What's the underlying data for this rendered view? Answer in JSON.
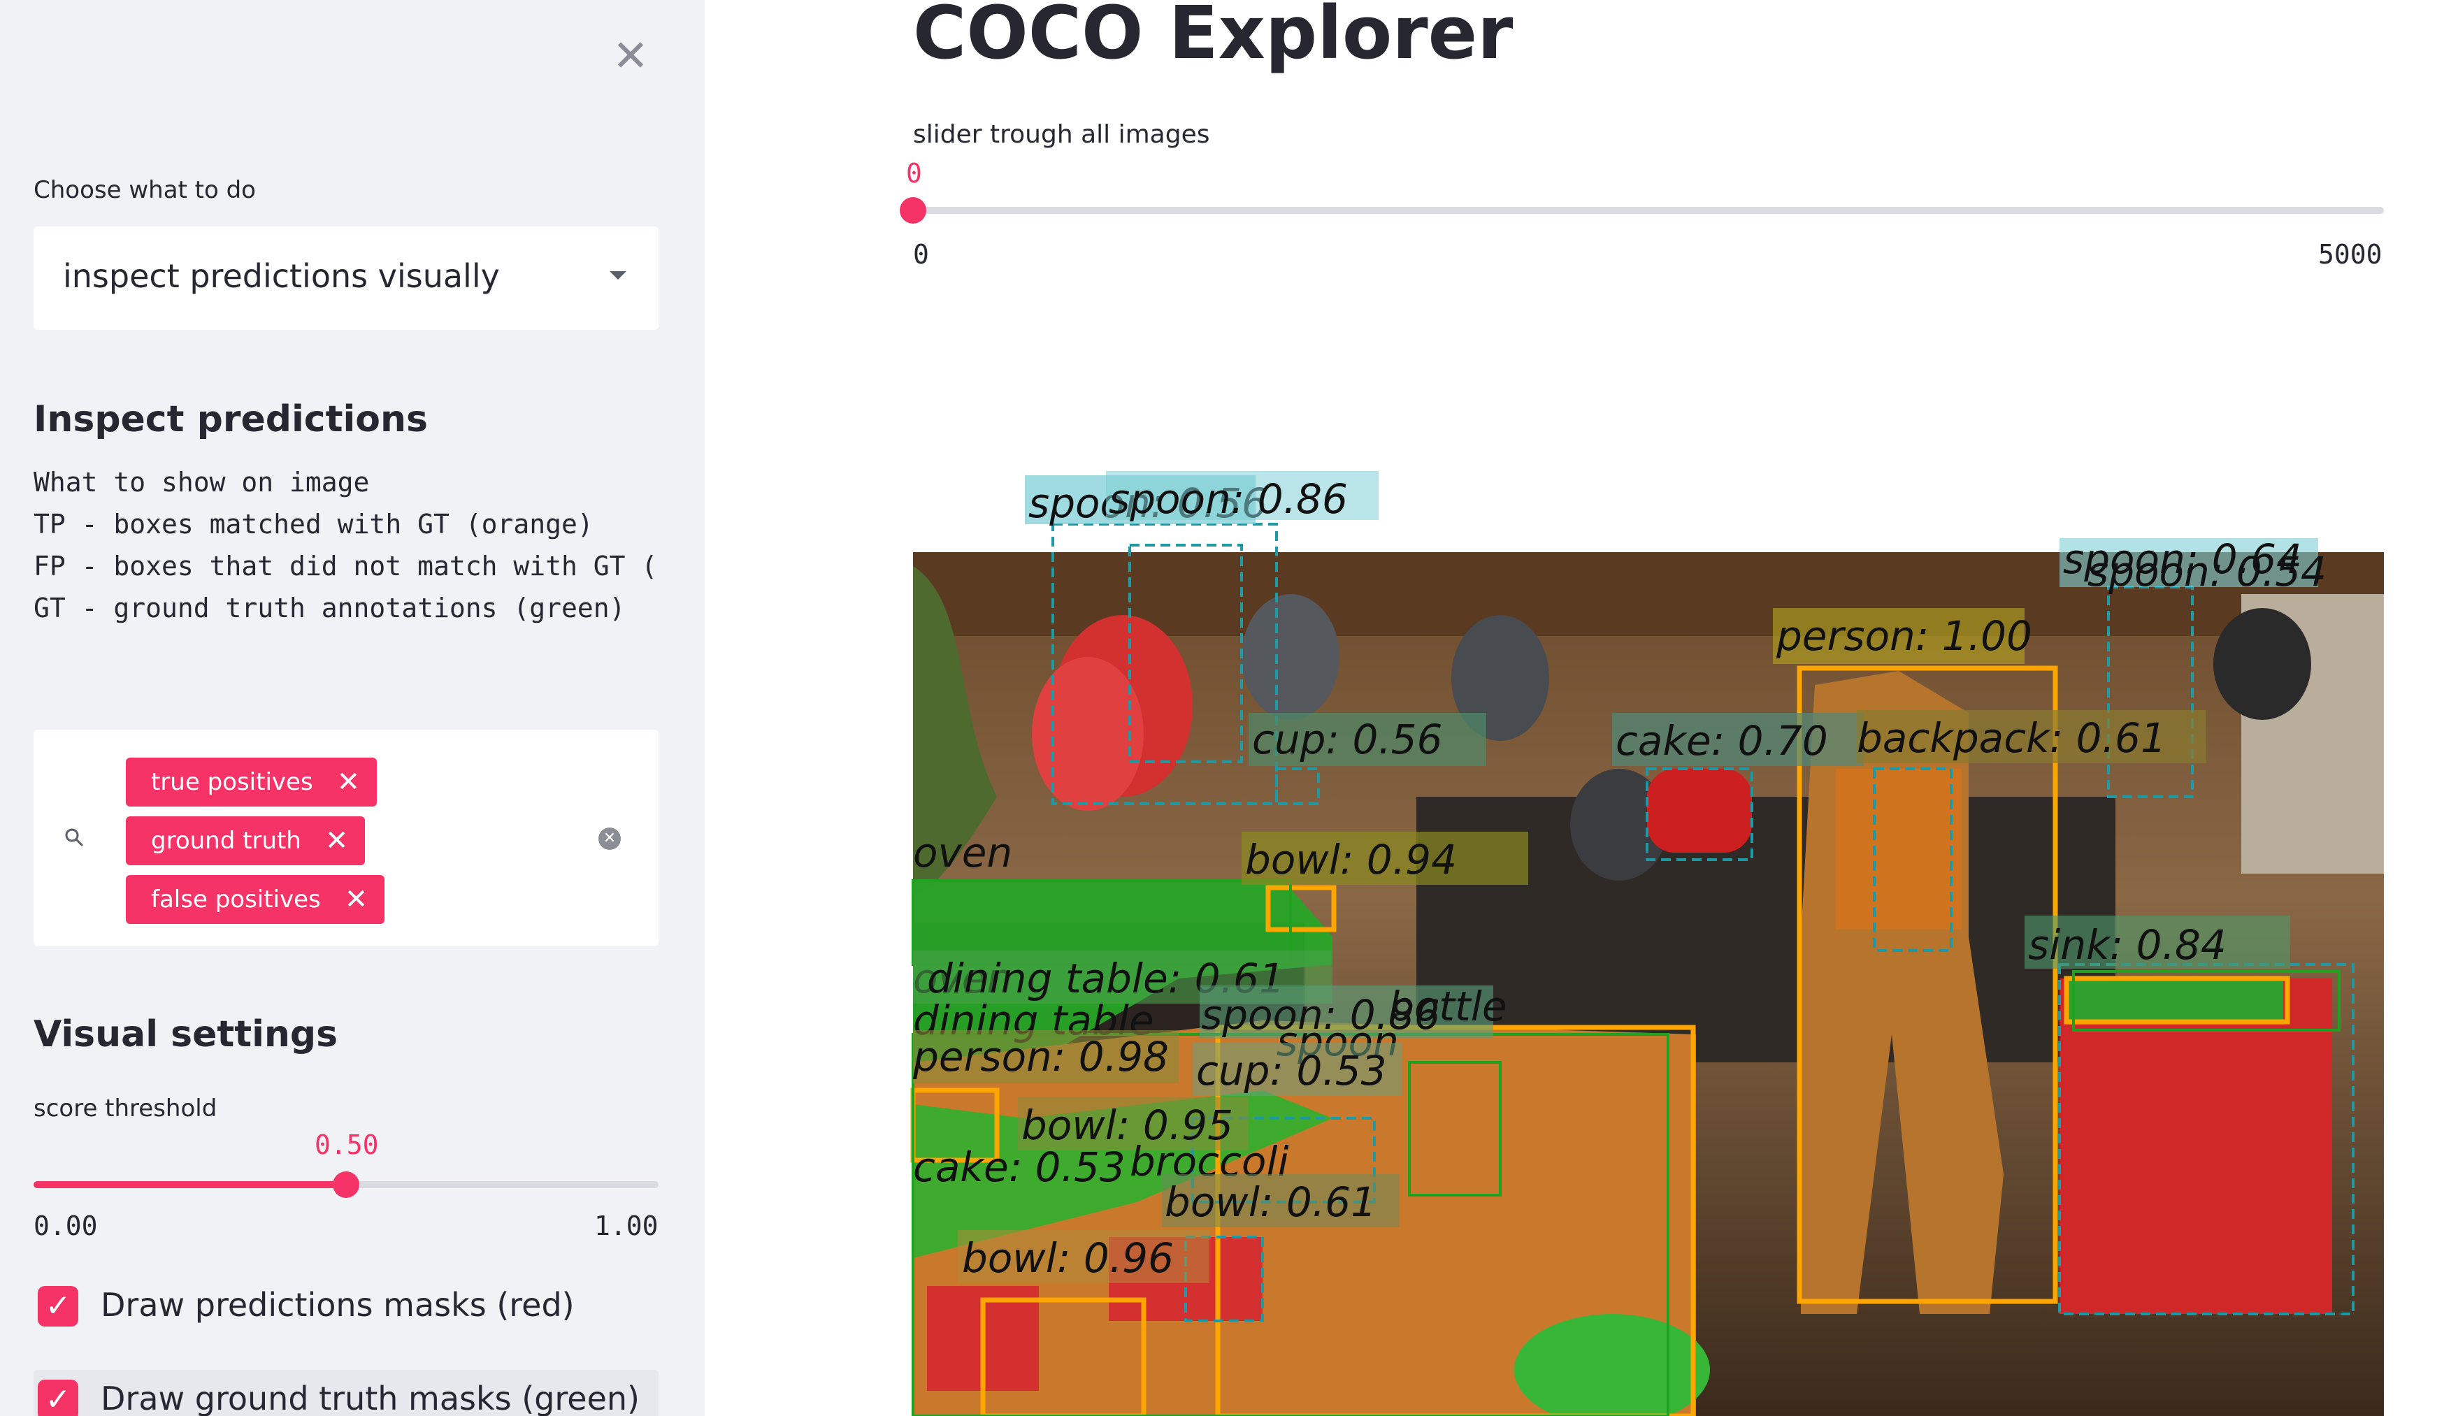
{
  "sidebar": {
    "close_icon": "close-icon",
    "action_label": "Choose what to do",
    "action_value": "inspect predictions visually",
    "inspect_heading": "Inspect predictions",
    "legend_lines": [
      "What to show on image",
      "TP - boxes matched with GT (orange)",
      "FP - boxes that did not match with GT (",
      "GT - ground truth annotations (green)"
    ],
    "show_tags": [
      "true positives",
      "ground truth",
      "false positives"
    ],
    "visual_heading": "Visual settings",
    "threshold": {
      "label": "score threshold",
      "value_text": "0.50",
      "value": 0.5,
      "min_text": "0.00",
      "max_text": "1.00"
    },
    "checkboxes": [
      {
        "label": "Draw predictions masks (red)",
        "checked": true
      },
      {
        "label": "Draw ground truth masks (green)",
        "checked": true
      }
    ]
  },
  "main": {
    "title": "COCO Explorer",
    "slider": {
      "label": "slider trough all images",
      "value_text": "0",
      "value": 0,
      "min_text": "0",
      "max_text": "5000"
    }
  },
  "image": {
    "labels": [
      "spoon: 0.56",
      "spoon: 0.86",
      "spoon: 0.64",
      "spoon: 0.54",
      "person: 1.00",
      "cup: 0.56",
      "cake: 0.70",
      "backpack: 0.61",
      "oven",
      "oven",
      "bowl: 0.94",
      "sink: 0.84",
      "dining table: 0.61",
      "dining table",
      "spoon: 0.86",
      "bottle",
      "spoon",
      "person: 0.98",
      "cup: 0.53",
      "bowl: 0.95",
      "cake: 0.53",
      "broccoli",
      "bowl: 0.61",
      "bowl: 0.96"
    ]
  },
  "colors": {
    "accent": "#f63366",
    "sidebar_bg": "#f0f2f6",
    "tp_box": "#ffa500",
    "gt_box": "#21a121",
    "fp_box": "#1f9aa5"
  }
}
